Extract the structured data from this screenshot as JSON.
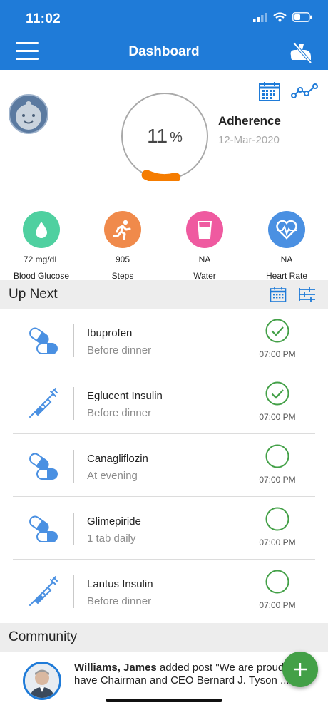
{
  "status_bar": {
    "time": "11:02"
  },
  "header": {
    "title": "Dashboard"
  },
  "adherence": {
    "percent": "11",
    "percent_sign": "%",
    "percent_value": 0.11,
    "label": "Adherence",
    "date": "12-Mar-2020"
  },
  "metrics": [
    {
      "value": "72 mg/dL",
      "label": "Blood Glucose",
      "color": "#4fd0a0",
      "icon": "droplet-icon"
    },
    {
      "value": "905",
      "label": "Steps",
      "color": "#f08a4b",
      "icon": "runner-icon"
    },
    {
      "value": "NA",
      "label": "Water",
      "color": "#ef5aa0",
      "icon": "glass-icon"
    },
    {
      "value": "NA",
      "label": "Heart Rate",
      "color": "#4a90e2",
      "icon": "heart-rate-icon"
    }
  ],
  "up_next": {
    "title": "Up Next",
    "items": [
      {
        "name": "Ibuprofen",
        "note": "Before dinner",
        "time": "07:00 PM",
        "done": true,
        "icon": "pill-icon"
      },
      {
        "name": "Eglucent Insulin",
        "note": "Before dinner",
        "time": "07:00 PM",
        "done": true,
        "icon": "syringe-icon"
      },
      {
        "name": "Canagliflozin",
        "note": "At evening",
        "time": "07:00 PM",
        "done": false,
        "icon": "pill-icon"
      },
      {
        "name": "Glimepiride",
        "note": "1 tab daily",
        "time": "07:00 PM",
        "done": false,
        "icon": "pill-icon"
      },
      {
        "name": "Lantus Insulin",
        "note": "Before dinner",
        "time": "07:00 PM",
        "done": false,
        "icon": "syringe-icon"
      }
    ]
  },
  "community": {
    "title": "Community",
    "post": {
      "author": "Williams, James",
      "text": " added post \"We are proud to have Chairman and CEO Bernard J. Tyson ..."
    }
  },
  "colors": {
    "brand": "#1f7bd8",
    "check_green": "#43a047",
    "ring_orange": "#f57c00"
  }
}
